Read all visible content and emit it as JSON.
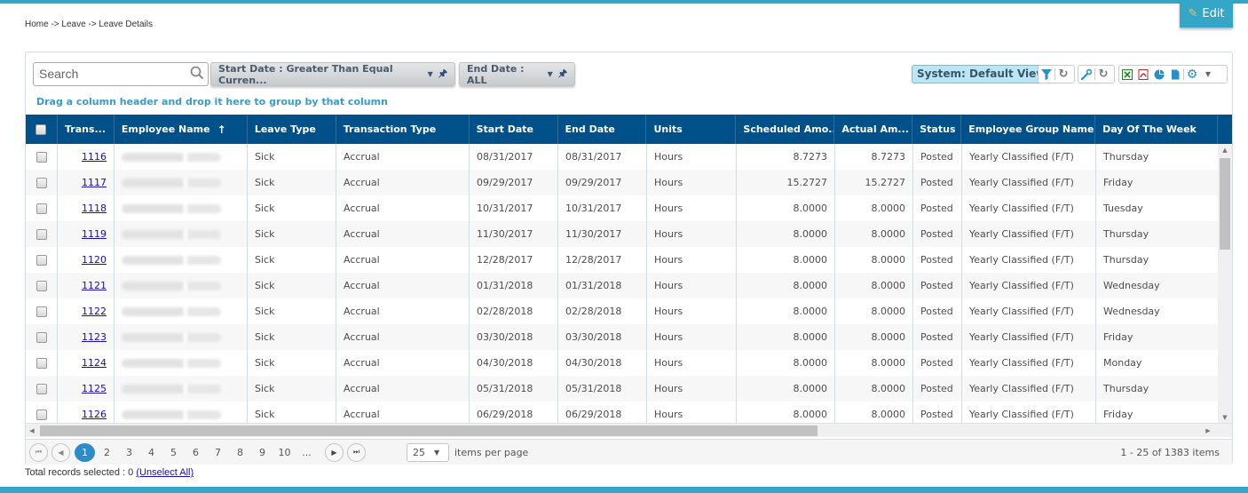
{
  "header": {
    "edit_label": "Edit",
    "breadcrumb": "Home -> Leave -> Leave Details"
  },
  "toolbar": {
    "search_placeholder": "Search",
    "filters": [
      {
        "label": "Start Date : Greater Than Equal Curren..."
      },
      {
        "label": "End Date : ALL"
      }
    ],
    "group_hint": "Drag a column header and drop it here to group by that column",
    "view_label": "System: Default View",
    "icons": [
      "filter-icon",
      "reset-filter-icon",
      "wrench-icon",
      "reset-columns-icon",
      "excel-icon",
      "pdf-icon",
      "chart-icon",
      "document-icon",
      "gear-icon"
    ]
  },
  "grid": {
    "columns": [
      {
        "label": ""
      },
      {
        "label": "Trans..."
      },
      {
        "label": "Employee Name",
        "sort": "asc"
      },
      {
        "label": "Leave Type"
      },
      {
        "label": "Transaction Type"
      },
      {
        "label": "Start Date"
      },
      {
        "label": "End Date"
      },
      {
        "label": "Units"
      },
      {
        "label": "Scheduled Amo..."
      },
      {
        "label": "Actual Am..."
      },
      {
        "label": "Status"
      },
      {
        "label": "Employee Group Name"
      },
      {
        "label": "Day Of The Week"
      }
    ],
    "rows": [
      {
        "id": "1116",
        "name": "",
        "leave": "Sick",
        "txn": "Accrual",
        "start": "08/31/2017",
        "end": "08/31/2017",
        "units": "Hours",
        "sched": "8.7273",
        "actual": "8.7273",
        "status": "Posted",
        "group": "Yearly Classified (F/T)",
        "day": "Thursday"
      },
      {
        "id": "1117",
        "name": "",
        "leave": "Sick",
        "txn": "Accrual",
        "start": "09/29/2017",
        "end": "09/29/2017",
        "units": "Hours",
        "sched": "15.2727",
        "actual": "15.2727",
        "status": "Posted",
        "group": "Yearly Classified (F/T)",
        "day": "Friday"
      },
      {
        "id": "1118",
        "name": "",
        "leave": "Sick",
        "txn": "Accrual",
        "start": "10/31/2017",
        "end": "10/31/2017",
        "units": "Hours",
        "sched": "8.0000",
        "actual": "8.0000",
        "status": "Posted",
        "group": "Yearly Classified (F/T)",
        "day": "Tuesday"
      },
      {
        "id": "1119",
        "name": "",
        "leave": "Sick",
        "txn": "Accrual",
        "start": "11/30/2017",
        "end": "11/30/2017",
        "units": "Hours",
        "sched": "8.0000",
        "actual": "8.0000",
        "status": "Posted",
        "group": "Yearly Classified (F/T)",
        "day": "Thursday"
      },
      {
        "id": "1120",
        "name": "",
        "leave": "Sick",
        "txn": "Accrual",
        "start": "12/28/2017",
        "end": "12/28/2017",
        "units": "Hours",
        "sched": "8.0000",
        "actual": "8.0000",
        "status": "Posted",
        "group": "Yearly Classified (F/T)",
        "day": "Thursday"
      },
      {
        "id": "1121",
        "name": "",
        "leave": "Sick",
        "txn": "Accrual",
        "start": "01/31/2018",
        "end": "01/31/2018",
        "units": "Hours",
        "sched": "8.0000",
        "actual": "8.0000",
        "status": "Posted",
        "group": "Yearly Classified (F/T)",
        "day": "Wednesday"
      },
      {
        "id": "1122",
        "name": "",
        "leave": "Sick",
        "txn": "Accrual",
        "start": "02/28/2018",
        "end": "02/28/2018",
        "units": "Hours",
        "sched": "8.0000",
        "actual": "8.0000",
        "status": "Posted",
        "group": "Yearly Classified (F/T)",
        "day": "Wednesday"
      },
      {
        "id": "1123",
        "name": "",
        "leave": "Sick",
        "txn": "Accrual",
        "start": "03/30/2018",
        "end": "03/30/2018",
        "units": "Hours",
        "sched": "8.0000",
        "actual": "8.0000",
        "status": "Posted",
        "group": "Yearly Classified (F/T)",
        "day": "Friday"
      },
      {
        "id": "1124",
        "name": "",
        "leave": "Sick",
        "txn": "Accrual",
        "start": "04/30/2018",
        "end": "04/30/2018",
        "units": "Hours",
        "sched": "8.0000",
        "actual": "8.0000",
        "status": "Posted",
        "group": "Yearly Classified (F/T)",
        "day": "Monday"
      },
      {
        "id": "1125",
        "name": "",
        "leave": "Sick",
        "txn": "Accrual",
        "start": "05/31/2018",
        "end": "05/31/2018",
        "units": "Hours",
        "sched": "8.0000",
        "actual": "8.0000",
        "status": "Posted",
        "group": "Yearly Classified (F/T)",
        "day": "Thursday"
      },
      {
        "id": "1126",
        "name": "",
        "leave": "Sick",
        "txn": "Accrual",
        "start": "06/29/2018",
        "end": "06/29/2018",
        "units": "Hours",
        "sched": "8.0000",
        "actual": "8.0000",
        "status": "Posted",
        "group": "Yearly Classified (F/T)",
        "day": "Friday"
      }
    ]
  },
  "pager": {
    "pages": [
      "1",
      "2",
      "3",
      "4",
      "5",
      "6",
      "7",
      "8",
      "9",
      "10",
      "..."
    ],
    "current_page": "1",
    "page_size": "25",
    "per_page_label": "items per page",
    "info": "1 - 25 of 1383 items"
  },
  "footer": {
    "selected_label": "Total records selected : 0",
    "unselect_label": "(Unselect All)"
  },
  "colors": {
    "accent": "#34a7c9",
    "header_bg": "#00508a",
    "active_page": "#2e8bc9",
    "link": "#1a0dab"
  }
}
